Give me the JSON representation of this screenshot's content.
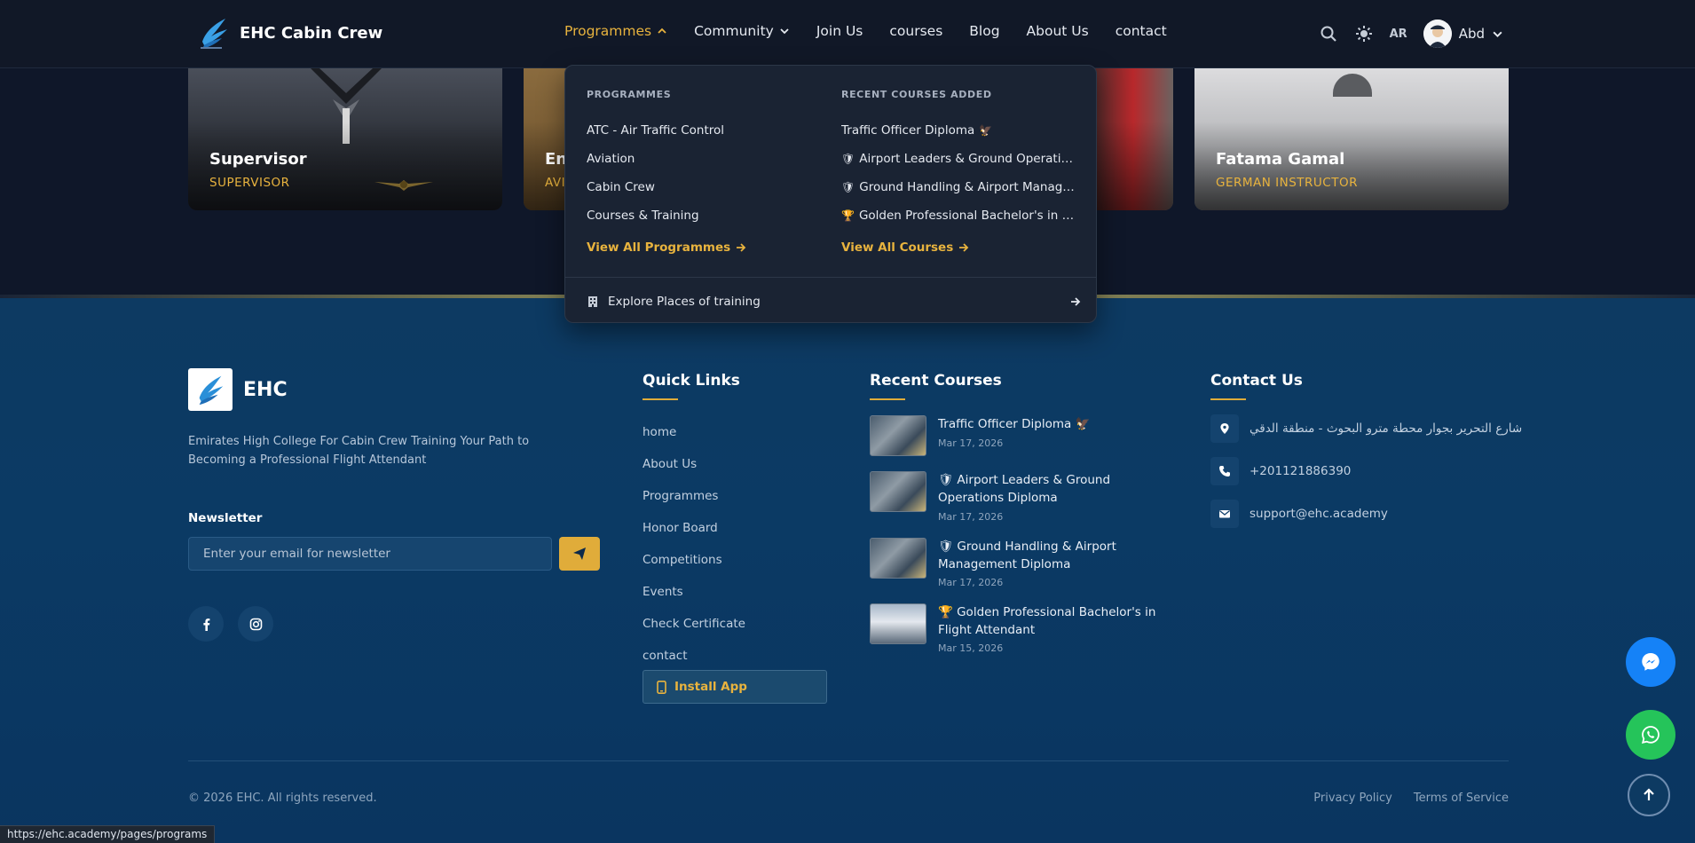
{
  "header": {
    "brand": "EHC Cabin Crew",
    "nav": [
      {
        "label": "Programmes",
        "has_dropdown": true,
        "active": true
      },
      {
        "label": "Community",
        "has_dropdown": true
      },
      {
        "label": "Join Us"
      },
      {
        "label": "courses"
      },
      {
        "label": "Blog"
      },
      {
        "label": "About Us"
      },
      {
        "label": "contact"
      }
    ],
    "lang": "AR",
    "user_name": "Abd",
    "icons": [
      "search-icon",
      "theme-gear-icon",
      "chevron-down-icon"
    ]
  },
  "team_cards": [
    {
      "name": "Supervisor",
      "role": "SUPERVISOR"
    },
    {
      "name": "En",
      "role": "AVI"
    },
    {
      "name": "",
      "role": ""
    },
    {
      "name": "Fatama Gamal",
      "role": "GERMAN INSTRUCTOR"
    }
  ],
  "dropdown": {
    "programmes_heading": "PROGRAMMES",
    "programmes": [
      "ATC - Air Traffic Control",
      "Aviation",
      "Cabin Crew",
      "Courses & Training"
    ],
    "view_programmes": "View All Programmes",
    "courses_heading": "RECENT COURSES ADDED",
    "courses": [
      {
        "emoji_before": "",
        "title": "Traffic Officer Diploma",
        "emoji_after": "🦅"
      },
      {
        "emoji_before": "🛡",
        "title": "Airport Leaders & Ground Operations Di...",
        "emoji_after": ""
      },
      {
        "emoji_before": "🛡",
        "title": "Ground Handling & Airport Managemen...",
        "emoji_after": ""
      },
      {
        "emoji_before": "🏆",
        "title": "Golden Professional Bachelor's in Fligh...",
        "emoji_after": ""
      }
    ],
    "view_courses": "View All Courses",
    "explore": "Explore Places of training"
  },
  "footer": {
    "brand": "EHC",
    "description": "Emirates High College For Cabin Crew Training Your Path to Becoming a Professional Flight Attendant",
    "newsletter_title": "Newsletter",
    "newsletter_placeholder": "Enter your email for newsletter",
    "social": [
      "facebook-icon",
      "instagram-icon"
    ],
    "quick_links_title": "Quick Links",
    "quick_links": [
      "home",
      "About Us",
      "Programmes",
      "Honor Board",
      "Competitions",
      "Events",
      "Check Certificate",
      "contact"
    ],
    "install_app": "Install App",
    "recent_courses_title": "Recent Courses",
    "recent_courses": [
      {
        "title": "Traffic Officer Diploma 🦅",
        "date": "Mar 17, 2026"
      },
      {
        "title": "🛡 Airport Leaders & Ground Operations Diploma",
        "date": "Mar 17, 2026"
      },
      {
        "title": "🛡 Ground Handling & Airport Management Diploma",
        "date": "Mar 17, 2026"
      },
      {
        "title": "🏆 Golden Professional Bachelor's in Flight Attendant",
        "date": "Mar 15, 2026"
      }
    ],
    "contact_title": "Contact Us",
    "contact": {
      "address": "شارع التحرير بجوار محطة مترو البحوث - منطقة الدقي",
      "phone": "+201121886390",
      "email": "support@ehc.academy"
    },
    "copyright": "© 2026 EHC. All rights reserved.",
    "privacy": "Privacy Policy",
    "terms": "Terms of Service"
  },
  "status_url": "https://ehc.academy/pages/programs",
  "colors": {
    "accent": "#e8b33e",
    "header_bg": "#111827",
    "footer_bg": "#0b3a64"
  }
}
